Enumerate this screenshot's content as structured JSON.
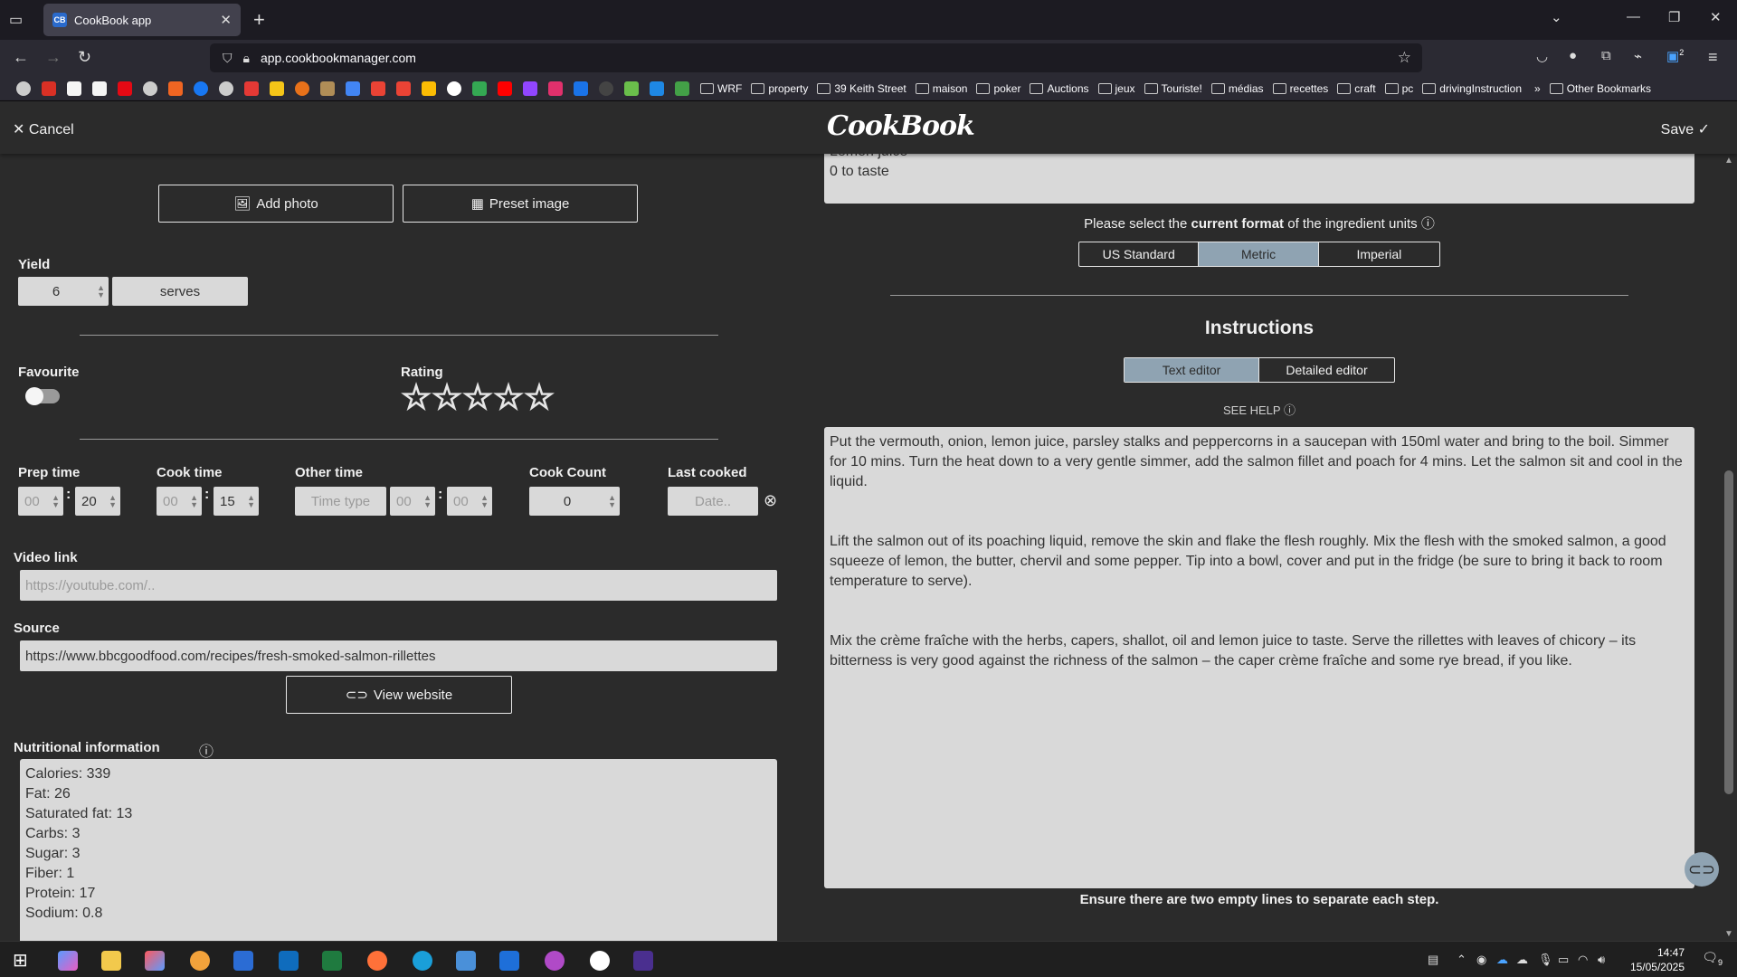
{
  "browser": {
    "tab_title": "CookBook app",
    "tab_favicon": "CB",
    "url_host": "app.cookbookmanager.com",
    "bookmarks": [
      "WRF",
      "property",
      "39 Keith Street",
      "maison",
      "poker",
      "Auctions",
      "jeux",
      "Touriste!",
      "médias",
      "recettes",
      "craft",
      "pc",
      "drivingInstruction"
    ],
    "other_bookmarks": "Other Bookmarks",
    "extension_badge": "2"
  },
  "header": {
    "cancel_label": "Cancel",
    "logo": "CookBook",
    "save_label": "Save"
  },
  "left": {
    "add_photo_label": "Add photo",
    "preset_image_label": "Preset image",
    "yield_label": "Yield",
    "yield_value": "6",
    "yield_unit": "serves",
    "favourite_label": "Favourite",
    "favourite_on": false,
    "rating_label": "Rating",
    "rating_value": 0,
    "rating_max": 5,
    "prep_time_label": "Prep time",
    "prep_hours": "00",
    "prep_minutes": "20",
    "cook_time_label": "Cook time",
    "cook_hours": "00",
    "cook_minutes": "15",
    "other_time_label": "Other time",
    "other_time_type_placeholder": "Time type",
    "other_hours": "00",
    "other_minutes": "00",
    "cook_count_label": "Cook Count",
    "cook_count_value": "0",
    "last_cooked_label": "Last cooked",
    "last_cooked_placeholder": "Date..",
    "video_link_label": "Video link",
    "video_link_placeholder": "https://youtube.com/..",
    "source_label": "Source",
    "source_value": "https://www.bbcgoodfood.com/recipes/fresh-smoked-salmon-rillettes",
    "view_website_label": "View website",
    "nutrition_label": "Nutritional information",
    "nutrition_lines": [
      "Calories: 339",
      "Fat: 26",
      "Saturated fat: 13",
      "Carbs: 3",
      "Sugar: 3",
      "Fiber: 1",
      "Protein: 17",
      "Sodium: 0.8"
    ]
  },
  "right": {
    "ingredients_cut_line": "Lemon juice",
    "ingredients_last_line": "0 to taste",
    "units_prompt_pre": "Please select the ",
    "units_prompt_bold": "current format",
    "units_prompt_post": " of the ingredient units",
    "unit_options": [
      "US Standard",
      "Metric",
      "Imperial"
    ],
    "unit_selected": "Metric",
    "instructions_title": "Instructions",
    "editor_options": [
      "Text editor",
      "Detailed editor"
    ],
    "editor_selected": "Text editor",
    "see_help_label": "SEE HELP",
    "instruction_steps": [
      "Put the vermouth, onion, lemon juice, parsley stalks and peppercorns in a saucepan with 150ml water and bring to the boil. Simmer for 10 mins. Turn the heat down to a very gentle simmer, add the salmon fillet and poach for 4 mins. Let the salmon sit and cool in the liquid.",
      "Lift the salmon out of its poaching liquid, remove the skin and flake the flesh roughly. Mix the flesh with the smoked salmon, a good squeeze of lemon, the butter, chervil and some pepper. Tip into a bowl, cover and put in the fridge (be sure to bring it back to room temperature to serve).",
      "Mix the crème fraîche with the herbs, capers, shallot, oil and lemon juice to taste. Serve the rillettes with leaves of chicory – its bitterness is very good against the richness of the salmon – the caper crème fraîche and some rye bread, if you like."
    ],
    "instructions_hint": "Ensure there are two empty lines to separate each step."
  },
  "taskbar": {
    "time": "14:47",
    "date": "15/05/2025",
    "notification_count": "9"
  },
  "colors": {
    "page_bg": "#2b2b2b",
    "field_bg": "#d9d9d9",
    "accent": "#8fa3b2"
  }
}
